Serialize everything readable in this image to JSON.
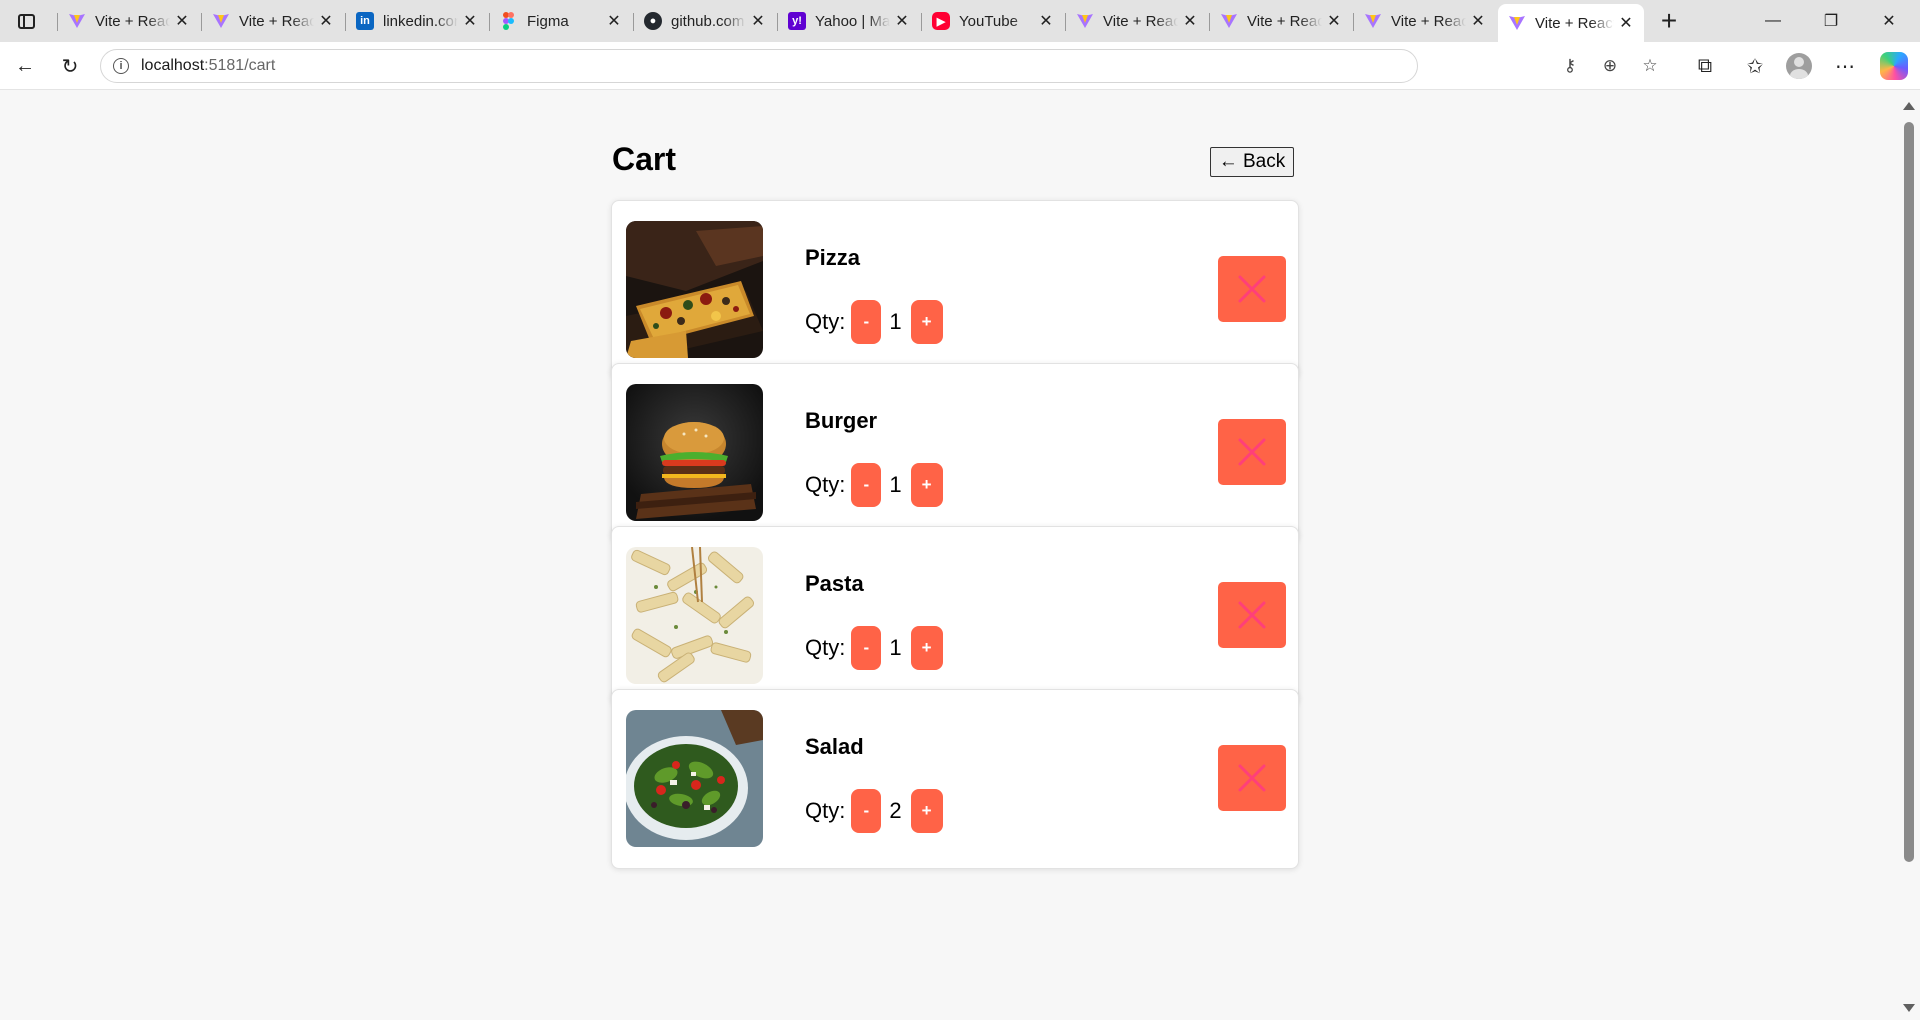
{
  "browser": {
    "tabs": [
      {
        "title": "Vite + React",
        "favicon": "vite-icon",
        "active": false
      },
      {
        "title": "Vite + React",
        "favicon": "vite-icon",
        "active": false
      },
      {
        "title": "linkedin.com",
        "favicon": "linkedin-icon",
        "active": false
      },
      {
        "title": "Figma",
        "favicon": "figma-icon",
        "active": false
      },
      {
        "title": "github.com",
        "favicon": "github-icon",
        "active": false
      },
      {
        "title": "Yahoo | Mail",
        "favicon": "yahoo-icon",
        "active": false
      },
      {
        "title": "YouTube",
        "favicon": "youtube-icon",
        "active": false
      },
      {
        "title": "Vite + React",
        "favicon": "vite-icon",
        "active": false
      },
      {
        "title": "Vite + React",
        "favicon": "vite-icon",
        "active": false
      },
      {
        "title": "Vite + React",
        "favicon": "vite-icon",
        "active": false
      },
      {
        "title": "Vite + React",
        "favicon": "vite-icon",
        "active": true
      }
    ],
    "address": {
      "host": "localhost",
      "path": ":5181/cart"
    }
  },
  "page": {
    "title": "Cart",
    "back_label": "← Back",
    "qty_label": "Qty:",
    "minus_label": "-",
    "plus_label": "+",
    "accent_color": "#ff6347",
    "items": [
      {
        "name": "Pizza",
        "qty": "1",
        "image": "pizza-photo"
      },
      {
        "name": "Burger",
        "qty": "1",
        "image": "burger-photo"
      },
      {
        "name": "Pasta",
        "qty": "1",
        "image": "pasta-photo"
      },
      {
        "name": "Salad",
        "qty": "2",
        "image": "salad-photo"
      }
    ]
  }
}
